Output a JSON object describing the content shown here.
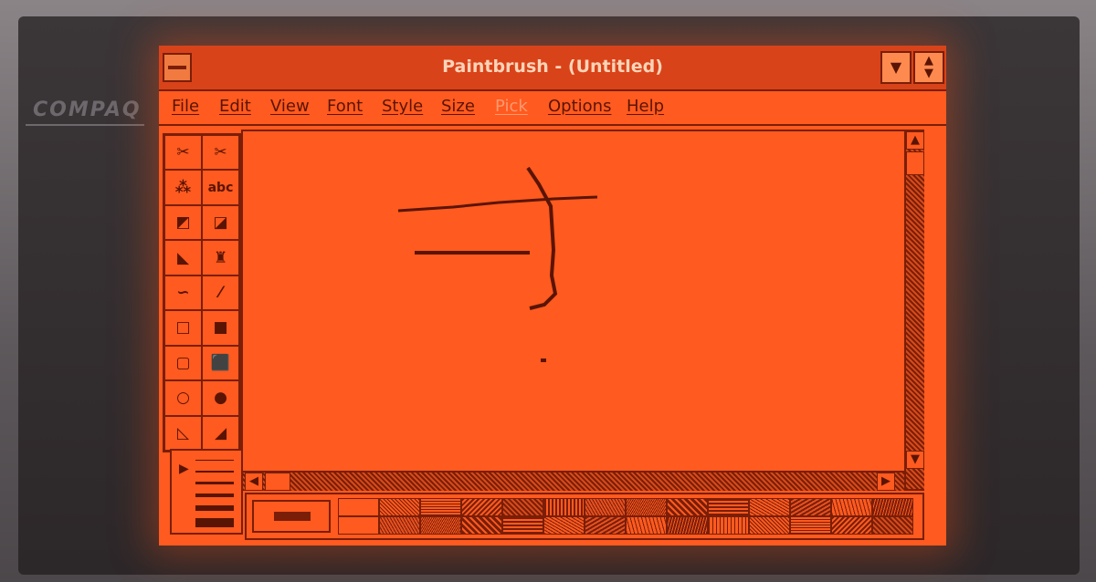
{
  "device": {
    "brand": "COMPAQ"
  },
  "window": {
    "title": "Paintbrush - (Untitled)"
  },
  "menu": {
    "items": [
      {
        "label": "File",
        "enabled": true
      },
      {
        "label": "Edit",
        "enabled": true
      },
      {
        "label": "View",
        "enabled": true
      },
      {
        "label": "Font",
        "enabled": true
      },
      {
        "label": "Style",
        "enabled": true
      },
      {
        "label": "Size",
        "enabled": true
      },
      {
        "label": "Pick",
        "enabled": false
      },
      {
        "label": "Options",
        "enabled": true
      },
      {
        "label": "Help",
        "enabled": true
      }
    ]
  },
  "toolbox": {
    "tools": [
      "scissors-icon",
      "pick-scissors-icon",
      "airbrush-icon",
      "text-icon",
      "color-eraser-icon",
      "eraser-icon",
      "paint-roller-icon",
      "brush-icon",
      "curve-icon",
      "line-icon",
      "box-icon",
      "filled-box-icon",
      "rounded-box-icon",
      "filled-rounded-box-icon",
      "circle-icon",
      "filled-circle-icon",
      "polygon-icon",
      "filled-polygon-icon"
    ],
    "text_tool_label": "abc"
  },
  "colors": {
    "screen": "#ff5a1f",
    "ink": "#5a1404",
    "titlebar": "#d9431a"
  }
}
